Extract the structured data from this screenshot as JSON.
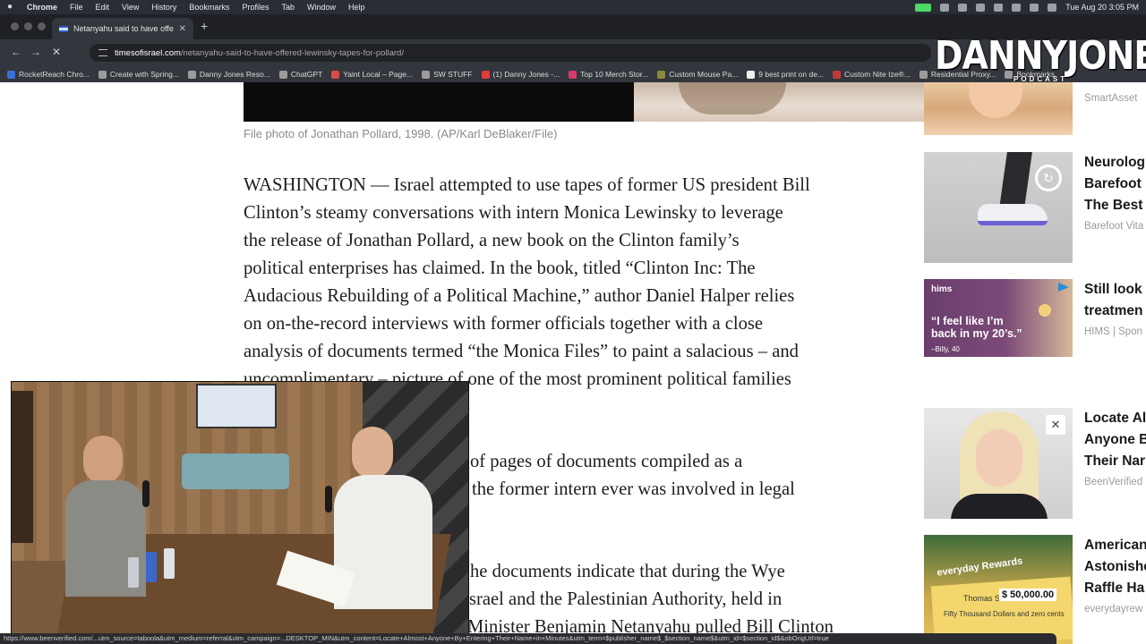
{
  "menubar": {
    "items": [
      "Chrome",
      "File",
      "Edit",
      "View",
      "History",
      "Bookmarks",
      "Profiles",
      "Tab",
      "Window",
      "Help"
    ],
    "clock": "Tue Aug 20  3:05 PM"
  },
  "tab": {
    "title": "Netanyahu said to have offered"
  },
  "address": {
    "host": "timesofisrael.com",
    "path": "/netanyahu-said-to-have-offered-lewinsky-tapes-for-pollard/"
  },
  "bookmarks": [
    {
      "label": "RocketReach Chro...",
      "color": "#3b6fd8"
    },
    {
      "label": "Create with Spring...",
      "color": "#9c9c9c"
    },
    {
      "label": "Danny Jones Reso...",
      "color": "#9c9c9c"
    },
    {
      "label": "ChatGPT",
      "color": "#9c9c9c"
    },
    {
      "label": "Yaint Local – Page...",
      "color": "#d94b4b"
    },
    {
      "label": "SW STUFF",
      "color": "#9c9c9c"
    },
    {
      "label": "(1) Danny Jones -...",
      "color": "#e23b3b"
    },
    {
      "label": "Top 10 Merch Stor...",
      "color": "#d93a6a"
    },
    {
      "label": "Custom Mouse Pa...",
      "color": "#8a8a3a"
    },
    {
      "label": "9 best print on de...",
      "color": "#eeeeee"
    },
    {
      "label": "Custom Nite Ize®...",
      "color": "#c23b3b"
    },
    {
      "label": "Residential Proxy...",
      "color": "#9c9c9c"
    },
    {
      "label": "Bookmarks",
      "color": "#9c9c9c"
    }
  ],
  "article": {
    "caption": "File photo of Jonathan Pollard, 1998. (AP/Karl DeBlaker/File)",
    "lines": [
      "WASHINGTON — Israel attempted to use tapes of former US president Bill",
      "Clinton’s steamy conversations with intern Monica Lewinsky to leverage",
      "the release of Jonathan Pollard, a new book on the Clinton family’s",
      "political enterprises has claimed. In the book, titled “Clinton Inc: The",
      "Audacious Rebuilding of a Political Machine,” author Daniel Halper relies",
      "on on-the-record interviews with former officials together with a close",
      "analysis of documents termed “the Monica Files” to paint a salacious – and",
      "uncomplimentary – picture of one of the most prominent political families"
    ],
    "fragments": [
      "of pages of documents compiled as a",
      "the former intern ever was involved in legal",
      "he documents indicate that during the Wye",
      "srael and the Palestinian Authority, held in",
      "Minister Benjamin Netanyahu pulled Bill Clinton"
    ]
  },
  "ads": [
    {
      "title": [],
      "source": "SmartAsset"
    },
    {
      "title": [
        "Neurolog",
        "Barefoot",
        "The Best"
      ],
      "source": "Barefoot Vita"
    },
    {
      "title": [
        "Still look",
        "treatmen"
      ],
      "source": "HIMS | Spon",
      "brand": "hims",
      "quote": "“I feel like I’m back in my 20’s.”",
      "cite": "–Billy, 40"
    },
    {
      "title": [
        "Locate Al",
        "Anyone B",
        "Their Nar"
      ],
      "source": "BeenVerified",
      "close": "✕"
    },
    {
      "title": [
        "American",
        "Astonishe",
        "Raffle Ha"
      ],
      "source": "everydayrew",
      "label": "everyday Rewards",
      "name": "Thomas S",
      "amount": "$ 50,000.00",
      "words": "Fifty Thousand Dollars and zero cents"
    }
  ],
  "logo": {
    "main": "DANNYJONES",
    "sub": "PODCAST"
  },
  "statusbar": {
    "url": "https://www.beenverified.com/...utm_source=taboola&utm_medium=referral&utm_campaign=...DESKTOP_MIN&utm_content=Locate+Almost+Anyone+By+Entering+Their+Name+in+Minutes&utm_term=$publisher_name$_$section_name$&utm_id=$section_id$&obOrigUrl=true"
  }
}
